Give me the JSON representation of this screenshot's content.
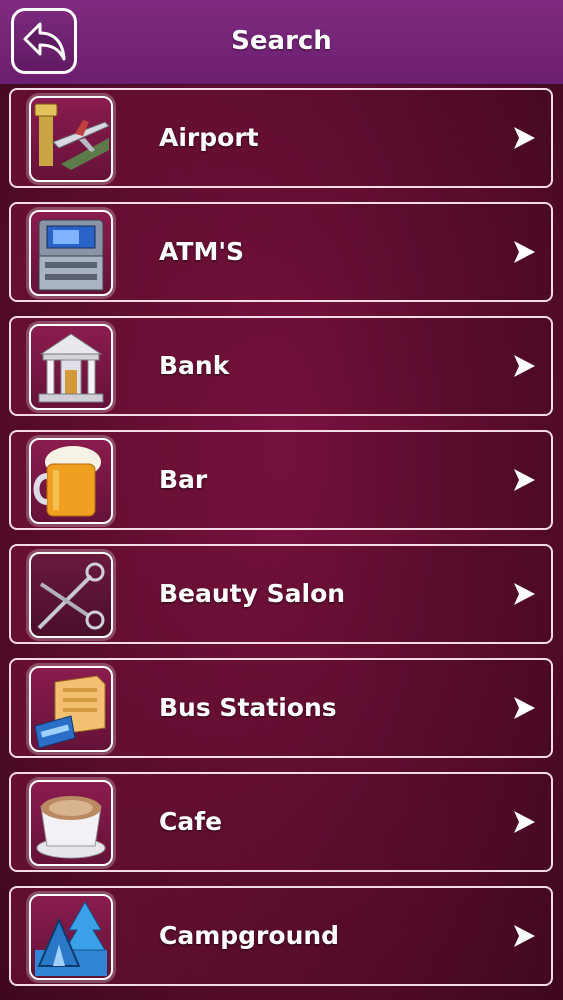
{
  "header": {
    "title": "Search",
    "back_icon": "back-arrow-icon"
  },
  "categories": [
    {
      "label": "Airport",
      "icon": "airport-icon"
    },
    {
      "label": "ATM'S",
      "icon": "atm-icon"
    },
    {
      "label": "Bank",
      "icon": "bank-icon"
    },
    {
      "label": "Bar",
      "icon": "beer-mug-icon"
    },
    {
      "label": "Beauty Salon",
      "icon": "scissors-icon"
    },
    {
      "label": "Bus Stations",
      "icon": "bus-station-icon"
    },
    {
      "label": "Cafe",
      "icon": "coffee-cup-icon"
    },
    {
      "label": "Campground",
      "icon": "campground-icon"
    }
  ],
  "colors": {
    "header": "#6d1f6f",
    "background": "#5a0c2c",
    "row_border": "#f3dbe6",
    "text": "#ffffff"
  }
}
